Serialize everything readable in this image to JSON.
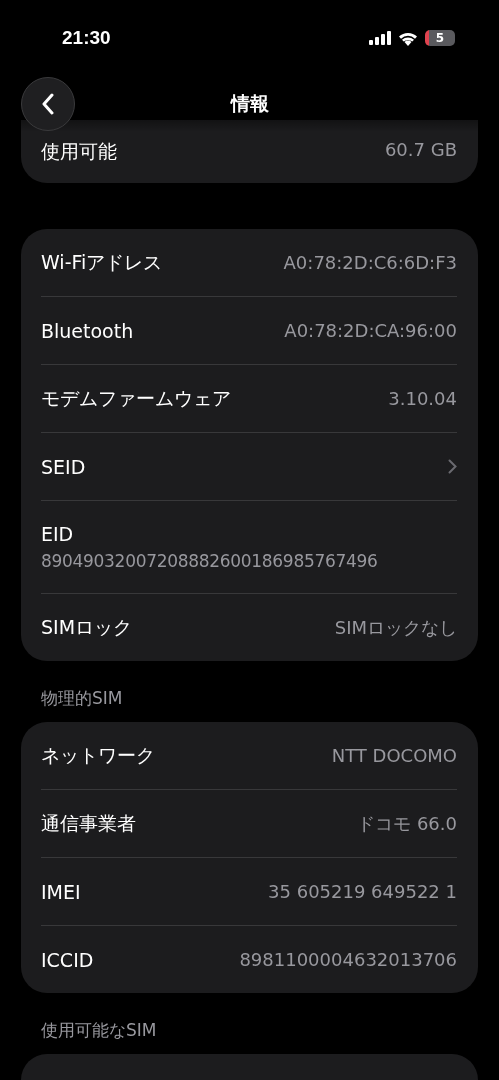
{
  "status_bar": {
    "time": "21:30",
    "battery": "5"
  },
  "header": {
    "title": "情報"
  },
  "sections": [
    {
      "rows": [
        {
          "kind": "value",
          "label": "使用可能",
          "value": "60.7 GB"
        }
      ]
    },
    {
      "rows": [
        {
          "kind": "value",
          "label": "Wi-Fiアドレス",
          "value": "A0:78:2D:C6:6D:F3"
        },
        {
          "kind": "value",
          "label": "Bluetooth",
          "value": "A0:78:2D:CA:96:00"
        },
        {
          "kind": "value",
          "label": "モデムファームウェア",
          "value": "3.10.04"
        },
        {
          "kind": "chevron",
          "label": "SEID"
        },
        {
          "kind": "stacked",
          "label": "EID",
          "value": "89049032007208882600186985767496"
        },
        {
          "kind": "value",
          "label": "SIMロック",
          "value": "SIMロックなし"
        }
      ]
    },
    {
      "title": "物理的SIM",
      "rows": [
        {
          "kind": "value",
          "label": "ネットワーク",
          "value": "NTT DOCOMO"
        },
        {
          "kind": "value",
          "label": "通信事業者",
          "value": "ドコモ 66.0"
        },
        {
          "kind": "value",
          "label": "IMEI",
          "value": "35 605219 649522 1"
        },
        {
          "kind": "value",
          "label": "ICCID",
          "value": "8981100004632013706"
        }
      ]
    },
    {
      "title": "使用可能なSIM"
    }
  ]
}
